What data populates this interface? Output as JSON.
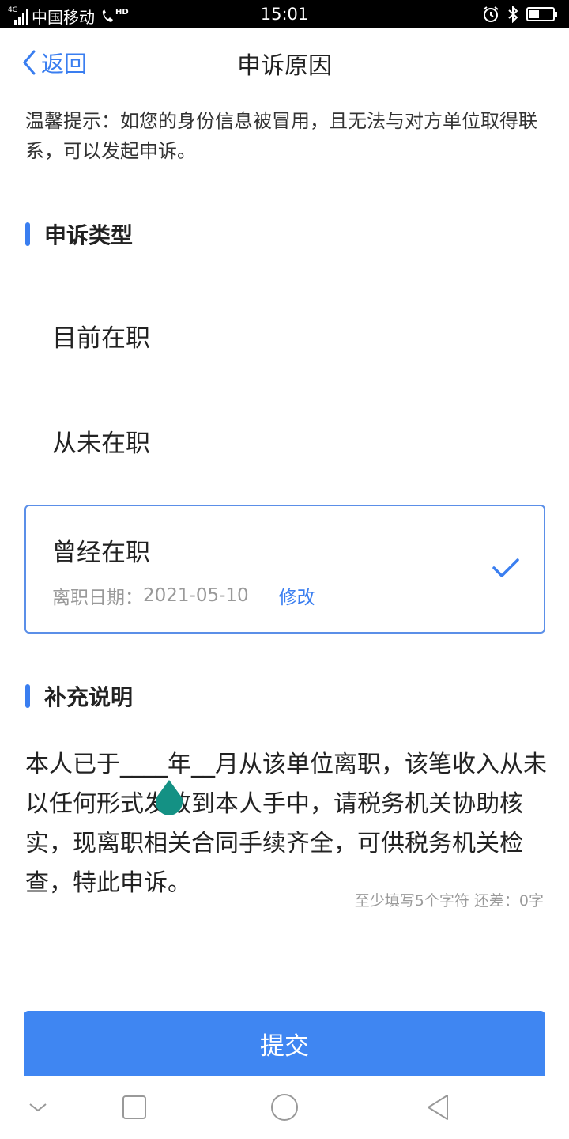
{
  "status_bar": {
    "network": "4G",
    "carrier": "中国移动",
    "hd": "HD",
    "time": "15:01",
    "icons": [
      "alarm-icon",
      "bluetooth-icon",
      "battery-icon"
    ]
  },
  "nav": {
    "back_label": "返回",
    "title": "申诉原因"
  },
  "tip": "温馨提示：如您的身份信息被冒用，且无法与对方单位取得联系，可以发起申诉。",
  "appeal_type": {
    "heading": "申诉类型",
    "options": [
      "目前在职",
      "从未在职"
    ],
    "selected": {
      "label": "曾经在职",
      "leave_date_label": "离职日期：",
      "leave_date": "2021-05-10",
      "modify_label": "修改"
    }
  },
  "supplement": {
    "heading": "补充说明",
    "text": "本人已于____年__月从该单位离职，该笔收入从未以任何形式发放到本人手中，请税务机关协助核实，现离职相关合同手续齐全，可供税务机关检查，特此申诉。",
    "counter": "至少填写5个字符 还差：0字"
  },
  "submit_label": "提交",
  "colors": {
    "accent": "#3a7ef0",
    "submit": "#3f86f2",
    "cursor_handle": "#149184"
  }
}
